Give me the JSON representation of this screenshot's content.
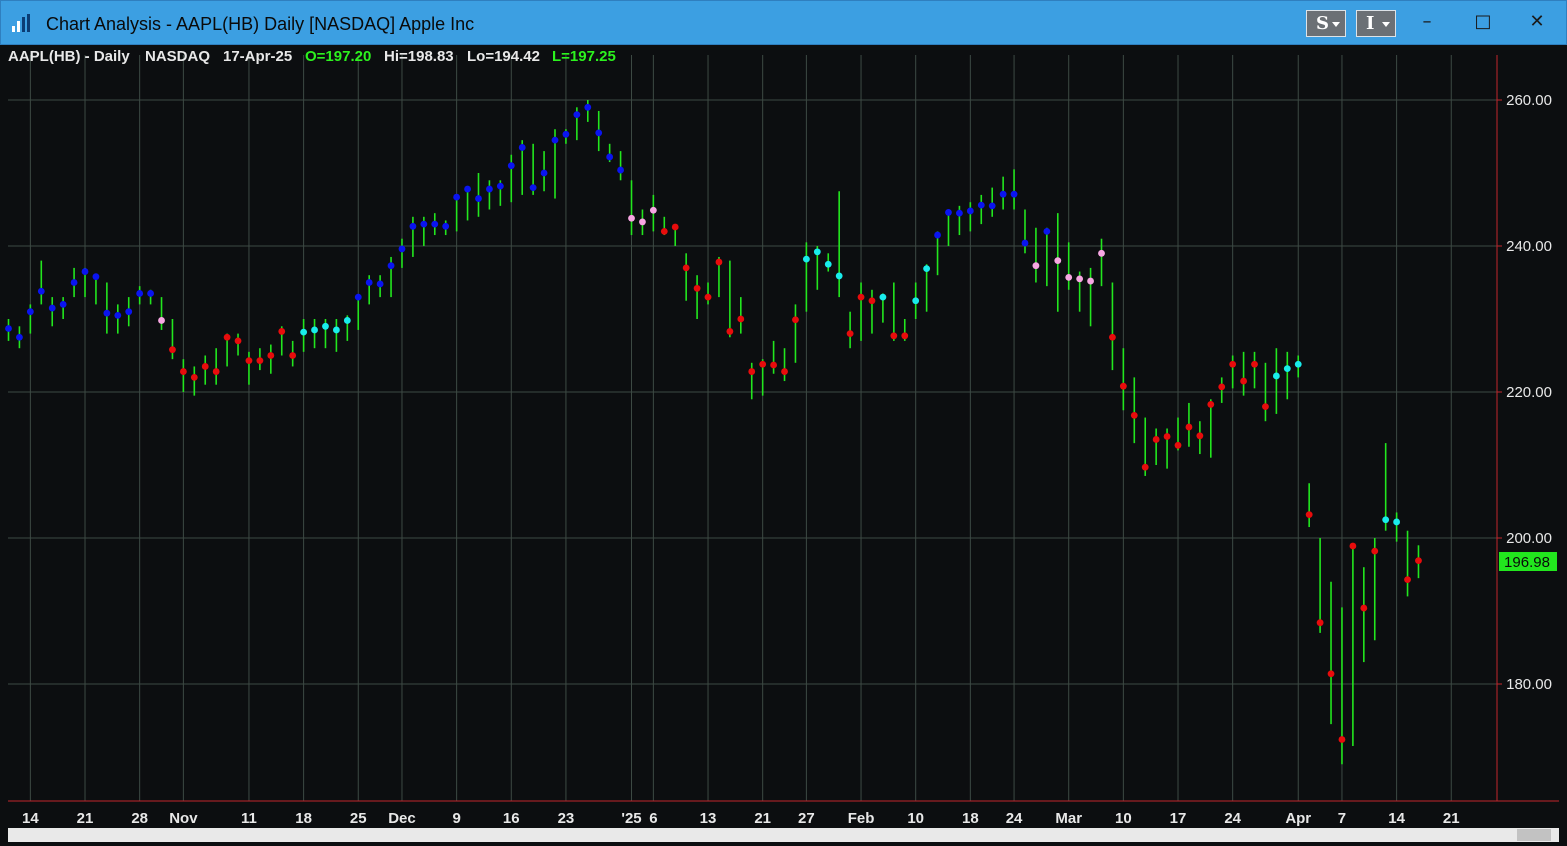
{
  "window": {
    "title": "Chart Analysis - AAPL(HB) Daily [NASDAQ] Apple Inc",
    "buttons": [
      {
        "label": "S",
        "icon": "s-dropdown-icon"
      },
      {
        "label": "I",
        "icon": "i-dropdown-icon"
      }
    ],
    "controls": {
      "minimize": "–",
      "maximize": "□",
      "close": "✕"
    }
  },
  "chart_header": {
    "symbol": "AAPL(HB) - Daily",
    "exchange": "NASDAQ",
    "date": "17-Apr-25",
    "open": "O=197.20",
    "high": "Hi=198.83",
    "low": "Lo=194.42",
    "last": "L=197.25"
  },
  "colors": {
    "background": "#0c0e10",
    "grid": "#3d4a44",
    "bar": "#22e61e",
    "axis_line": "#c2262c",
    "text": "#e8e8e8",
    "green_text": "#2cf21e",
    "last_price_bg": "#22e61e",
    "dot_blue": "#0a14f0",
    "dot_cyan": "#19ecec",
    "dot_pink": "#f7a6e2",
    "dot_red": "#e80c0c"
  },
  "chart_data": {
    "type": "ohlc",
    "ylim": [
      164,
      265
    ],
    "yticks": [
      180,
      200,
      220,
      240,
      260
    ],
    "ytick_labels": [
      "180.00",
      "200.00",
      "220.00",
      "240.00",
      "260.00"
    ],
    "last_price": "196.98",
    "x_labels": [
      {
        "label": "14",
        "i": 2
      },
      {
        "label": "21",
        "i": 7
      },
      {
        "label": "28",
        "i": 12
      },
      {
        "label": "Nov",
        "i": 16
      },
      {
        "label": "11",
        "i": 22
      },
      {
        "label": "18",
        "i": 27
      },
      {
        "label": "25",
        "i": 32
      },
      {
        "label": "Dec",
        "i": 36
      },
      {
        "label": "9",
        "i": 41
      },
      {
        "label": "16",
        "i": 46
      },
      {
        "label": "23",
        "i": 51
      },
      {
        "label": "'25",
        "i": 57
      },
      {
        "label": "6",
        "i": 59
      },
      {
        "label": "13",
        "i": 64
      },
      {
        "label": "21",
        "i": 69
      },
      {
        "label": "27",
        "i": 73
      },
      {
        "label": "Feb",
        "i": 78
      },
      {
        "label": "10",
        "i": 83
      },
      {
        "label": "18",
        "i": 88
      },
      {
        "label": "24",
        "i": 92
      },
      {
        "label": "Mar",
        "i": 97
      },
      {
        "label": "10",
        "i": 102
      },
      {
        "label": "17",
        "i": 107
      },
      {
        "label": "24",
        "i": 112
      },
      {
        "label": "Apr",
        "i": 118
      },
      {
        "label": "7",
        "i": 122
      },
      {
        "label": "14",
        "i": 127
      },
      {
        "label": "21",
        "i": 132
      }
    ],
    "bars": [
      {
        "h": 230,
        "l": 227,
        "c": 228.7,
        "s": "b"
      },
      {
        "h": 229,
        "l": 226,
        "c": 227.5,
        "s": "b"
      },
      {
        "h": 232,
        "l": 228,
        "c": 231,
        "s": "b"
      },
      {
        "h": 238,
        "l": 232,
        "c": 233.8,
        "s": "b"
      },
      {
        "h": 233,
        "l": 229,
        "c": 231.5,
        "s": "b"
      },
      {
        "h": 233,
        "l": 230,
        "c": 232,
        "s": "b"
      },
      {
        "h": 237,
        "l": 233,
        "c": 235,
        "s": "b"
      },
      {
        "h": 237,
        "l": 233,
        "c": 236.5,
        "s": "b"
      },
      {
        "h": 236,
        "l": 232,
        "c": 235.8,
        "s": "b"
      },
      {
        "h": 235,
        "l": 228,
        "c": 230.8,
        "s": "b"
      },
      {
        "h": 232,
        "l": 228,
        "c": 230.5,
        "s": "b"
      },
      {
        "h": 233,
        "l": 229,
        "c": 231,
        "s": "b"
      },
      {
        "h": 234.5,
        "l": 232,
        "c": 233.5,
        "s": "b"
      },
      {
        "h": 234,
        "l": 232,
        "c": 233.5,
        "s": "b"
      },
      {
        "h": 233,
        "l": 228.5,
        "c": 229.8,
        "s": "p"
      },
      {
        "h": 230,
        "l": 224.5,
        "c": 225.8,
        "s": "r"
      },
      {
        "h": 224.5,
        "l": 220,
        "c": 222.8,
        "s": "r"
      },
      {
        "h": 223.5,
        "l": 219.5,
        "c": 222,
        "s": "r"
      },
      {
        "h": 225,
        "l": 221,
        "c": 223.5,
        "s": "r"
      },
      {
        "h": 226,
        "l": 221,
        "c": 222.8,
        "s": "r"
      },
      {
        "h": 228,
        "l": 223.5,
        "c": 227.5,
        "s": "r"
      },
      {
        "h": 228,
        "l": 225,
        "c": 227,
        "s": "r"
      },
      {
        "h": 225.5,
        "l": 221,
        "c": 224.3,
        "s": "r"
      },
      {
        "h": 226,
        "l": 223,
        "c": 224.3,
        "s": "r"
      },
      {
        "h": 226.5,
        "l": 222.5,
        "c": 225,
        "s": "r"
      },
      {
        "h": 229,
        "l": 225,
        "c": 228.3,
        "s": "r"
      },
      {
        "h": 227,
        "l": 223.5,
        "c": 225,
        "s": "r"
      },
      {
        "h": 230,
        "l": 225.5,
        "c": 228.2,
        "s": "c"
      },
      {
        "h": 230,
        "l": 226,
        "c": 228.5,
        "s": "c"
      },
      {
        "h": 230,
        "l": 226,
        "c": 229,
        "s": "c"
      },
      {
        "h": 230,
        "l": 225.5,
        "c": 228.5,
        "s": "c"
      },
      {
        "h": 230.5,
        "l": 227,
        "c": 229.8,
        "s": "c"
      },
      {
        "h": 233,
        "l": 228.5,
        "c": 233,
        "s": "b"
      },
      {
        "h": 236,
        "l": 232,
        "c": 235,
        "s": "b"
      },
      {
        "h": 236,
        "l": 233,
        "c": 234.8,
        "s": "b"
      },
      {
        "h": 238.5,
        "l": 233,
        "c": 237.3,
        "s": "b"
      },
      {
        "h": 241,
        "l": 237,
        "c": 239.6,
        "s": "b"
      },
      {
        "h": 244,
        "l": 238.5,
        "c": 242.7,
        "s": "b"
      },
      {
        "h": 244,
        "l": 240,
        "c": 243,
        "s": "b"
      },
      {
        "h": 244.5,
        "l": 241.5,
        "c": 243,
        "s": "b"
      },
      {
        "h": 243.5,
        "l": 241.5,
        "c": 242.7,
        "s": "b"
      },
      {
        "h": 247,
        "l": 242,
        "c": 246.7,
        "s": "b"
      },
      {
        "h": 248,
        "l": 243.5,
        "c": 247.8,
        "s": "b"
      },
      {
        "h": 250,
        "l": 244,
        "c": 246.5,
        "s": "b"
      },
      {
        "h": 249,
        "l": 245,
        "c": 247.8,
        "s": "b"
      },
      {
        "h": 249,
        "l": 245.5,
        "c": 248.2,
        "s": "b"
      },
      {
        "h": 252.5,
        "l": 246,
        "c": 251,
        "s": "b"
      },
      {
        "h": 254.5,
        "l": 247,
        "c": 253.5,
        "s": "b"
      },
      {
        "h": 254,
        "l": 247,
        "c": 248,
        "s": "b"
      },
      {
        "h": 253,
        "l": 247.5,
        "c": 250,
        "s": "b"
      },
      {
        "h": 256,
        "l": 246.5,
        "c": 254.5,
        "s": "b"
      },
      {
        "h": 256,
        "l": 254,
        "c": 255.3,
        "s": "b"
      },
      {
        "h": 259,
        "l": 254.5,
        "c": 258,
        "s": "b"
      },
      {
        "h": 260,
        "l": 257,
        "c": 259,
        "s": "b"
      },
      {
        "h": 258.5,
        "l": 253,
        "c": 255.5,
        "s": "b"
      },
      {
        "h": 254,
        "l": 251.5,
        "c": 252.2,
        "s": "b"
      },
      {
        "h": 253,
        "l": 249,
        "c": 250.4,
        "s": "b"
      },
      {
        "h": 249,
        "l": 241.5,
        "c": 243.8,
        "s": "p"
      },
      {
        "h": 245,
        "l": 241.5,
        "c": 243.3,
        "s": "p"
      },
      {
        "h": 247,
        "l": 242,
        "c": 244.9,
        "s": "p"
      },
      {
        "h": 244,
        "l": 241.5,
        "c": 242,
        "s": "r"
      },
      {
        "h": 243,
        "l": 240,
        "c": 242.6,
        "s": "r"
      },
      {
        "h": 239,
        "l": 232.5,
        "c": 237,
        "s": "r"
      },
      {
        "h": 236,
        "l": 230,
        "c": 234.2,
        "s": "r"
      },
      {
        "h": 235,
        "l": 232,
        "c": 233,
        "s": "r"
      },
      {
        "h": 238.5,
        "l": 233,
        "c": 237.8,
        "s": "r"
      },
      {
        "h": 238,
        "l": 227.5,
        "c": 228.3,
        "s": "r"
      },
      {
        "h": 233,
        "l": 228,
        "c": 230,
        "s": "r"
      },
      {
        "h": 224,
        "l": 219,
        "c": 222.8,
        "s": "r"
      },
      {
        "h": 224.5,
        "l": 219.5,
        "c": 223.8,
        "s": "r"
      },
      {
        "h": 227,
        "l": 222.5,
        "c": 223.7,
        "s": "r"
      },
      {
        "h": 226,
        "l": 221.5,
        "c": 222.8,
        "s": "r"
      },
      {
        "h": 232,
        "l": 224,
        "c": 229.9,
        "s": "r"
      },
      {
        "h": 240.5,
        "l": 231,
        "c": 238.2,
        "s": "c"
      },
      {
        "h": 240,
        "l": 234,
        "c": 239.2,
        "s": "c"
      },
      {
        "h": 239,
        "l": 236.5,
        "c": 237.5,
        "s": "c"
      },
      {
        "h": 247.5,
        "l": 233,
        "c": 235.9,
        "s": "c"
      },
      {
        "h": 231,
        "l": 226,
        "c": 228,
        "s": "r"
      },
      {
        "h": 235,
        "l": 227,
        "c": 233,
        "s": "r"
      },
      {
        "h": 234,
        "l": 228,
        "c": 232.5,
        "s": "r"
      },
      {
        "h": 233.5,
        "l": 229.5,
        "c": 233,
        "s": "c"
      },
      {
        "h": 235,
        "l": 227,
        "c": 227.7,
        "s": "r"
      },
      {
        "h": 230,
        "l": 227,
        "c": 227.7,
        "s": "r"
      },
      {
        "h": 235,
        "l": 230,
        "c": 232.5,
        "s": "c"
      },
      {
        "h": 237.5,
        "l": 231,
        "c": 236.9,
        "s": "c"
      },
      {
        "h": 242,
        "l": 236,
        "c": 241.5,
        "s": "b"
      },
      {
        "h": 245,
        "l": 240,
        "c": 244.6,
        "s": "b"
      },
      {
        "h": 245.5,
        "l": 241.5,
        "c": 244.5,
        "s": "b"
      },
      {
        "h": 246,
        "l": 242,
        "c": 244.8,
        "s": "b"
      },
      {
        "h": 247,
        "l": 243,
        "c": 245.6,
        "s": "b"
      },
      {
        "h": 248,
        "l": 244,
        "c": 245.5,
        "s": "b"
      },
      {
        "h": 249.5,
        "l": 245,
        "c": 247.1,
        "s": "b"
      },
      {
        "h": 250.5,
        "l": 245,
        "c": 247.1,
        "s": "b"
      },
      {
        "h": 245,
        "l": 239,
        "c": 240.4,
        "s": "b"
      },
      {
        "h": 242.5,
        "l": 235,
        "c": 237.3,
        "s": "p"
      },
      {
        "h": 242.5,
        "l": 234.5,
        "c": 242,
        "s": "b"
      },
      {
        "h": 244.5,
        "l": 231,
        "c": 238,
        "s": "p"
      },
      {
        "h": 240.5,
        "l": 234,
        "c": 235.7,
        "s": "p"
      },
      {
        "h": 236.5,
        "l": 231,
        "c": 235.5,
        "s": "p"
      },
      {
        "h": 237,
        "l": 229,
        "c": 235.2,
        "s": "p"
      },
      {
        "h": 241,
        "l": 234.5,
        "c": 239,
        "s": "p"
      },
      {
        "h": 235,
        "l": 223,
        "c": 227.5,
        "s": "r"
      },
      {
        "h": 226,
        "l": 217.5,
        "c": 220.8,
        "s": "r"
      },
      {
        "h": 222,
        "l": 213,
        "c": 216.8,
        "s": "r"
      },
      {
        "h": 216.5,
        "l": 208.5,
        "c": 209.7,
        "s": "r"
      },
      {
        "h": 215,
        "l": 210,
        "c": 213.5,
        "s": "r"
      },
      {
        "h": 215,
        "l": 209.5,
        "c": 213.9,
        "s": "r"
      },
      {
        "h": 216.5,
        "l": 212,
        "c": 212.7,
        "s": "r"
      },
      {
        "h": 218.5,
        "l": 212.5,
        "c": 215.2,
        "s": "r"
      },
      {
        "h": 216,
        "l": 211.5,
        "c": 214,
        "s": "r"
      },
      {
        "h": 219,
        "l": 211,
        "c": 218.3,
        "s": "r"
      },
      {
        "h": 222,
        "l": 218.5,
        "c": 220.7,
        "s": "r"
      },
      {
        "h": 225,
        "l": 220.5,
        "c": 223.8,
        "s": "r"
      },
      {
        "h": 225.5,
        "l": 219.5,
        "c": 221.5,
        "s": "r"
      },
      {
        "h": 225.5,
        "l": 220.5,
        "c": 223.8,
        "s": "r"
      },
      {
        "h": 224,
        "l": 216,
        "c": 218,
        "s": "r"
      },
      {
        "h": 226,
        "l": 217,
        "c": 222.2,
        "s": "c"
      },
      {
        "h": 225.5,
        "l": 219,
        "c": 223.2,
        "s": "c"
      },
      {
        "h": 225,
        "l": 222,
        "c": 223.8,
        "s": "c"
      },
      {
        "h": 207.5,
        "l": 201.5,
        "c": 203.2,
        "s": "r"
      },
      {
        "h": 200,
        "l": 187,
        "c": 188.4,
        "s": "r"
      },
      {
        "h": 194,
        "l": 174.5,
        "c": 181.4,
        "s": "r"
      },
      {
        "h": 190.5,
        "l": 169,
        "c": 172.4,
        "s": "r"
      },
      {
        "h": 199,
        "l": 171.5,
        "c": 198.9,
        "s": "r"
      },
      {
        "h": 196,
        "l": 183,
        "c": 190.4,
        "s": "r"
      },
      {
        "h": 200,
        "l": 186,
        "c": 198.2,
        "s": "r"
      },
      {
        "h": 213,
        "l": 201,
        "c": 202.5,
        "s": "c"
      },
      {
        "h": 203.5,
        "l": 199.5,
        "c": 202.2,
        "s": "c"
      },
      {
        "h": 201,
        "l": 192,
        "c": 194.3,
        "s": "r"
      },
      {
        "h": 199,
        "l": 194.5,
        "c": 196.9,
        "s": "r"
      }
    ]
  }
}
